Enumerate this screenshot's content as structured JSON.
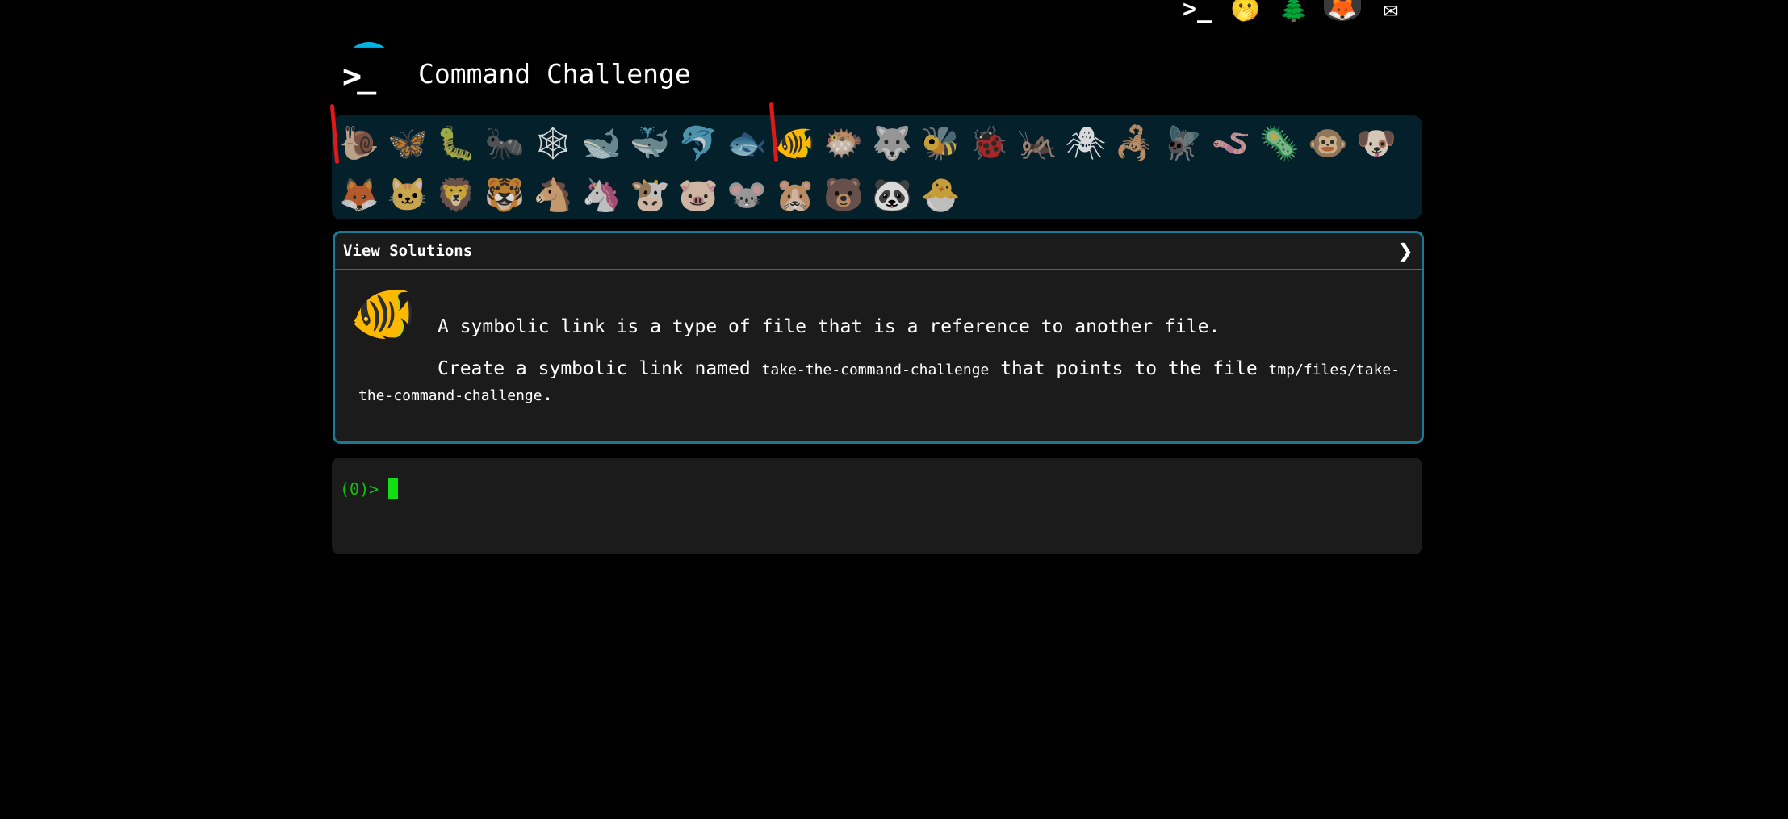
{
  "top_icons": [
    {
      "name": "terminal-icon",
      "glyph": ">_"
    },
    {
      "name": "face-icon",
      "glyph": "🫢"
    },
    {
      "name": "tree-icon",
      "glyph": "🌲"
    },
    {
      "name": "gitlab-icon",
      "glyph": "🦊"
    },
    {
      "name": "mail-icon",
      "glyph": "✉"
    }
  ],
  "header": {
    "logo_glyph": ">_",
    "title": "Command Challenge"
  },
  "animals": [
    {
      "name": "snail",
      "glyph": "🐌"
    },
    {
      "name": "butterfly",
      "glyph": "🦋"
    },
    {
      "name": "caterpillar",
      "glyph": "🐛"
    },
    {
      "name": "ant",
      "glyph": "🐜"
    },
    {
      "name": "web",
      "glyph": "🕸"
    },
    {
      "name": "whale",
      "glyph": "🐋"
    },
    {
      "name": "whale2",
      "glyph": "🐳"
    },
    {
      "name": "dolphin",
      "glyph": "🐬"
    },
    {
      "name": "fish",
      "glyph": "🐟"
    },
    {
      "name": "tropical-fish",
      "glyph": "🐠",
      "current": true
    },
    {
      "name": "blowfish",
      "glyph": "🐡"
    },
    {
      "name": "wolf",
      "glyph": "🐺"
    },
    {
      "name": "bee",
      "glyph": "🐝"
    },
    {
      "name": "ladybug",
      "glyph": "🐞"
    },
    {
      "name": "cricket",
      "glyph": "🦗"
    },
    {
      "name": "spider",
      "glyph": "🕷"
    },
    {
      "name": "scorpion",
      "glyph": "🦂"
    },
    {
      "name": "fly",
      "glyph": "🪰"
    },
    {
      "name": "worm",
      "glyph": "🪱"
    },
    {
      "name": "microbe",
      "glyph": "🦠"
    },
    {
      "name": "monkey",
      "glyph": "🐵"
    },
    {
      "name": "dog",
      "glyph": "🐶"
    },
    {
      "name": "fox",
      "glyph": "🦊"
    },
    {
      "name": "cat",
      "glyph": "🐱"
    },
    {
      "name": "lion",
      "glyph": "🦁"
    },
    {
      "name": "tiger",
      "glyph": "🐯"
    },
    {
      "name": "horse",
      "glyph": "🐴"
    },
    {
      "name": "unicorn",
      "glyph": "🦄"
    },
    {
      "name": "cow",
      "glyph": "🐮"
    },
    {
      "name": "pig",
      "glyph": "🐷"
    },
    {
      "name": "mouse",
      "glyph": "🐭"
    },
    {
      "name": "hamster",
      "glyph": "🐹"
    },
    {
      "name": "bear",
      "glyph": "🐻"
    },
    {
      "name": "panda",
      "glyph": "🐼"
    },
    {
      "name": "chick",
      "glyph": "🐣"
    }
  ],
  "solutions": {
    "title": "View Solutions",
    "toggle_glyph": "❯"
  },
  "challenge": {
    "image_glyph": "🐠",
    "intro": "A symbolic link is a type of file that is a reference to another file.",
    "task_prefix": "Create a symbolic link named ",
    "link_name": "take-the-command-challenge",
    "task_middle": " that points to the file ",
    "target_path": "tmp/files/take-the-command-challenge",
    "task_suffix": "."
  },
  "terminal": {
    "prompt": "(0)>"
  },
  "colors": {
    "background": "#000000",
    "logo_accent": "#06b4e4",
    "panel_border": "#1a7a95",
    "animal_bar_bg": "#04202b",
    "prompt_green": "#10c010",
    "marker_red": "#e01818"
  }
}
